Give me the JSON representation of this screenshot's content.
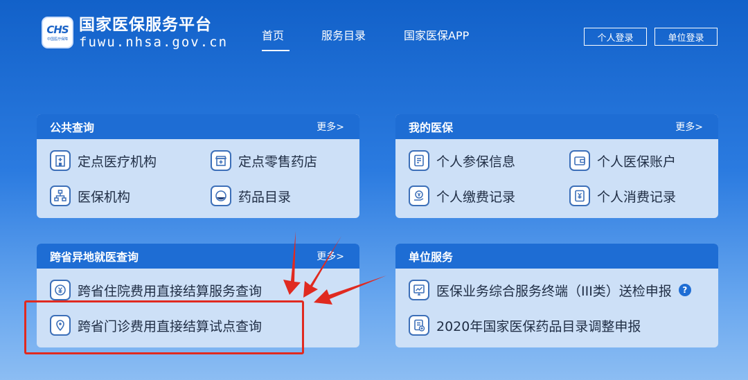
{
  "logo": {
    "mark": "CHS",
    "mark_sub": "中国医疗保障",
    "title": "国家医保服务平台",
    "domain": "fuwu.nhsa.gov.cn"
  },
  "nav": [
    {
      "label": "首页",
      "active": true
    },
    {
      "label": "服务目录"
    },
    {
      "label": "国家医保APP"
    }
  ],
  "login": {
    "personal": "个人登录",
    "unit": "单位登录"
  },
  "cards": {
    "public": {
      "title": "公共查询",
      "more": "更多>",
      "items": [
        {
          "label": "定点医疗机构",
          "icon": "hospital-building-icon"
        },
        {
          "label": "定点零售药店",
          "icon": "pharmacy-store-icon"
        },
        {
          "label": "医保机构",
          "icon": "org-chart-icon"
        },
        {
          "label": "药品目录",
          "icon": "pill-capsule-icon"
        }
      ]
    },
    "mine": {
      "title": "我的医保",
      "more": "更多>",
      "items": [
        {
          "label": "个人参保信息",
          "icon": "insurance-document-icon"
        },
        {
          "label": "个人医保账户",
          "icon": "wallet-icon"
        },
        {
          "label": "个人缴费记录",
          "icon": "payment-hand-icon"
        },
        {
          "label": "个人消费记录",
          "icon": "yuan-receipt-icon"
        }
      ]
    },
    "cross": {
      "title": "跨省异地就医查询",
      "more": "更多>",
      "items": [
        {
          "label": "跨省住院费用直接结算服务查询",
          "icon": "yuan-coin-icon"
        },
        {
          "label": "跨省门诊费用直接结算试点查询",
          "icon": "location-pin-icon"
        }
      ]
    },
    "unit": {
      "title": "单位服务",
      "items": [
        {
          "label": "医保业务综合服务终端（III类）送检申报",
          "icon": "chart-monitor-icon",
          "help": "?"
        },
        {
          "label": "2020年国家医保药品目录调整申报",
          "icon": "document-add-icon"
        }
      ]
    }
  },
  "colors": {
    "accent": "#1e6dd4",
    "card_bg": "#cde0f7",
    "annotation_red": "#e02a20"
  }
}
